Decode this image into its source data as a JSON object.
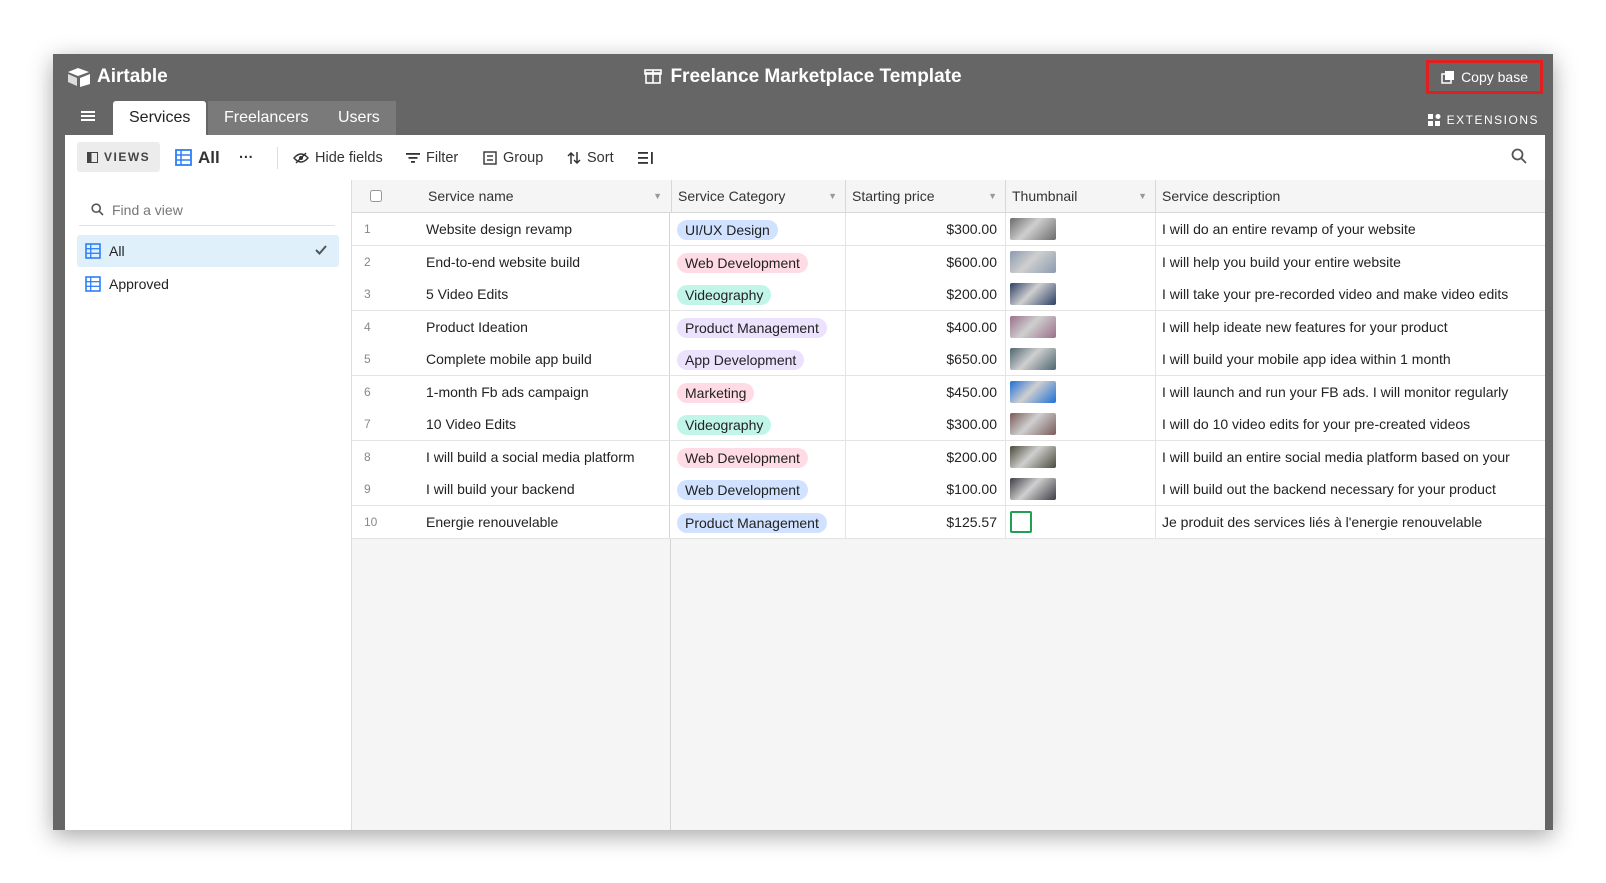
{
  "app": {
    "name": "Airtable"
  },
  "base": {
    "title": "Freelance Marketplace Template",
    "copy_label": "Copy base"
  },
  "tabs": [
    {
      "label": "Services",
      "active": true
    },
    {
      "label": "Freelancers",
      "active": false
    },
    {
      "label": "Users",
      "active": false
    }
  ],
  "extensions_label": "EXTENSIONS",
  "toolbar": {
    "views_label": "VIEWS",
    "current_view": "All",
    "more": "···",
    "hide_fields": "Hide fields",
    "filter": "Filter",
    "group": "Group",
    "sort": "Sort"
  },
  "sidebar": {
    "find_placeholder": "Find a view",
    "views": [
      {
        "label": "All",
        "selected": true
      },
      {
        "label": "Approved",
        "selected": false
      }
    ]
  },
  "columns": [
    "Service name",
    "Service Category",
    "Starting price",
    "Thumbnail",
    "Service description"
  ],
  "rows": [
    {
      "num": "1",
      "name": "Website design revamp",
      "category": "UI/UX Design",
      "cat_color": "#d0e2ff",
      "price": "$300.00",
      "thumb": "laptop-photo",
      "thumb_color": "#6b6b6b",
      "desc": "I will do an entire revamp of your website"
    },
    {
      "num": "2",
      "name": "End-to-end website build",
      "category": "Web Development",
      "cat_color": "#ffdce5",
      "price": "$600.00",
      "thumb": "desk-photo",
      "thumb_color": "#8a9bb0",
      "desc": "I will help you build your entire website"
    },
    {
      "num": "3",
      "name": "5 Video Edits",
      "category": "Videography",
      "cat_color": "#c2f5e9",
      "price": "$200.00",
      "thumb": "editing-screen-photo",
      "thumb_color": "#2c3e66",
      "desc": "I will take your pre-recorded video and make video edits"
    },
    {
      "num": "4",
      "name": "Product Ideation",
      "category": "Product Management",
      "cat_color": "#ede2fe",
      "price": "$400.00",
      "thumb": "sticky-notes-photo",
      "thumb_color": "#9b6f8a",
      "desc": "I will help ideate new features for your product"
    },
    {
      "num": "5",
      "name": "Complete mobile app build",
      "category": "App Development",
      "cat_color": "#ede2fe",
      "price": "$650.00",
      "thumb": "phone-photo",
      "thumb_color": "#4d6670",
      "desc": "I will build your mobile app idea within 1 month"
    },
    {
      "num": "6",
      "name": "1-month Fb ads campaign",
      "category": "Marketing",
      "cat_color": "#ffdce5",
      "price": "$450.00",
      "thumb": "facebook-photo",
      "thumb_color": "#1f6fd6",
      "desc": "I will launch and run your FB ads. I will monitor regularly"
    },
    {
      "num": "7",
      "name": "10 Video Edits",
      "category": "Videography",
      "cat_color": "#c2f5e9",
      "price": "$300.00",
      "thumb": "collage-photo",
      "thumb_color": "#7a5a5a",
      "desc": "I will do 10 video edits for your pre-created videos"
    },
    {
      "num": "8",
      "name": "I will build a social media platform",
      "category": "Web Development",
      "cat_color": "#ffdce5",
      "price": "$200.00",
      "thumb": "devices-photo",
      "thumb_color": "#4a4a3a",
      "desc": "I will build an entire social media platform based on your"
    },
    {
      "num": "9",
      "name": "I will build your backend",
      "category": "Web Development",
      "cat_color": "#d0e2ff",
      "price": "$100.00",
      "thumb": "server-photo",
      "thumb_color": "#3d3d45",
      "desc": "I will build out the backend necessary for your product"
    },
    {
      "num": "10",
      "name": "Energie renouvelable",
      "category": "Product Management",
      "cat_color": "#d0e2ff",
      "price": "$125.57",
      "thumb": "green-logo",
      "thumb_color": "#20a050",
      "desc": "Je produit des services liés à l'energie renouvelable"
    }
  ]
}
